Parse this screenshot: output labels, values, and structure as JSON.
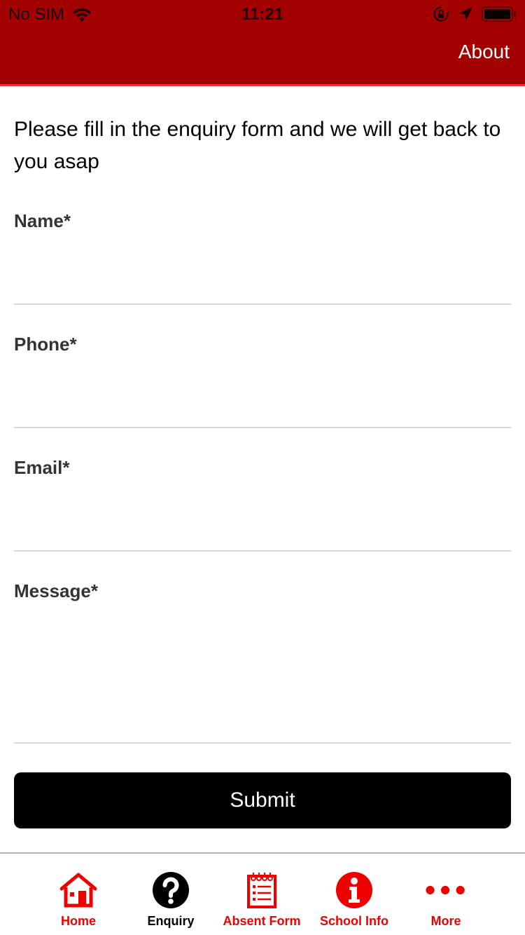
{
  "status_bar": {
    "carrier": "No SIM",
    "time": "11:21",
    "icons": [
      "wifi-icon",
      "orientation-lock-icon",
      "location-arrow-icon",
      "battery-icon"
    ]
  },
  "header": {
    "about_label": "About",
    "background_color": "#a30000",
    "accent_line_color": "#e8303a"
  },
  "intro_text": "Please fill in the enquiry form and we will get back to you asap",
  "form": {
    "fields": [
      {
        "label": "Name*",
        "value": "",
        "placeholder": ""
      },
      {
        "label": "Phone*",
        "value": "",
        "placeholder": ""
      },
      {
        "label": "Email*",
        "value": "",
        "placeholder": ""
      },
      {
        "label": "Message*",
        "value": "",
        "placeholder": ""
      }
    ],
    "submit_label": "Submit"
  },
  "tab_bar": {
    "active_color": "#000000",
    "inactive_color": "#ee0000",
    "items": [
      {
        "label": "Home",
        "icon": "home-icon",
        "active": false
      },
      {
        "label": "Enquiry",
        "icon": "question-circle-icon",
        "active": true
      },
      {
        "label": "Absent Form",
        "icon": "notepad-list-icon",
        "active": false
      },
      {
        "label": "School Info",
        "icon": "info-circle-icon",
        "active": false
      },
      {
        "label": "More",
        "icon": "more-dots-icon",
        "active": false
      }
    ]
  }
}
